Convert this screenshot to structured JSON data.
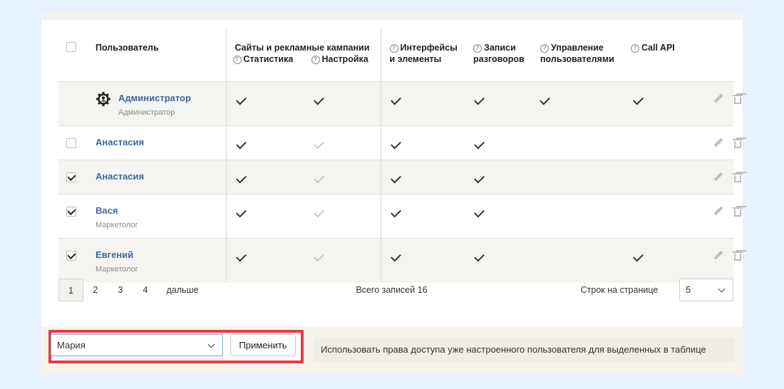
{
  "table": {
    "headers": {
      "user": "Пользователь",
      "sites_group": "Сайты и рекламные кампании",
      "stats": "Статистика",
      "settings": "Настройка",
      "interfaces_line1": "Интерфейсы",
      "interfaces_line2": "и элементы",
      "records_line1": "Записи",
      "records_line2": "разговоров",
      "user_mgmt_line1": "Управление",
      "user_mgmt_line2": "пользователями",
      "call_api": "Call API"
    },
    "rows": [
      {
        "name": "Администратор",
        "role": "Администратор",
        "selected": false,
        "is_admin": true,
        "stats": true,
        "settings": true,
        "interfaces": true,
        "records": true,
        "user_mgmt": true,
        "call_api": true
      },
      {
        "name": "Анастасия",
        "role": "",
        "selected": false,
        "is_admin": false,
        "stats": true,
        "settings": false,
        "interfaces": true,
        "records": true,
        "user_mgmt": false,
        "call_api": false
      },
      {
        "name": "Анастасия",
        "role": "",
        "selected": true,
        "is_admin": false,
        "stats": true,
        "settings": false,
        "interfaces": true,
        "records": true,
        "user_mgmt": false,
        "call_api": false
      },
      {
        "name": "Вася",
        "role": "Маркетолог",
        "selected": true,
        "is_admin": false,
        "stats": true,
        "settings": false,
        "interfaces": true,
        "records": true,
        "user_mgmt": false,
        "call_api": false
      },
      {
        "name": "Евгений",
        "role": "Маркетолог",
        "selected": true,
        "is_admin": false,
        "stats": true,
        "settings": false,
        "interfaces": true,
        "records": true,
        "user_mgmt": false,
        "call_api": true
      }
    ]
  },
  "pagination": {
    "pages": [
      "1",
      "2",
      "3",
      "4"
    ],
    "current_page": "1",
    "next_label": "дальше",
    "total_label": "Всего записей 16",
    "rows_per_page_label": "Строк на странице",
    "rows_per_page_value": "5"
  },
  "bulk": {
    "user_select_value": "Мария",
    "apply_label": "Применить",
    "hint": "Использовать права доступа уже настроенного пользователя для выделенных в таблице"
  },
  "icons": {
    "help": "question-circle-icon",
    "edit": "pencil-icon",
    "delete": "trash-icon",
    "admin": "gear-admin-icon",
    "dropdown": "chevron-down-icon"
  },
  "colors": {
    "background": "#e8f2fd",
    "link": "#3f67a0",
    "highlight": "#e8394b",
    "row_shade": "#f5f4f0"
  }
}
